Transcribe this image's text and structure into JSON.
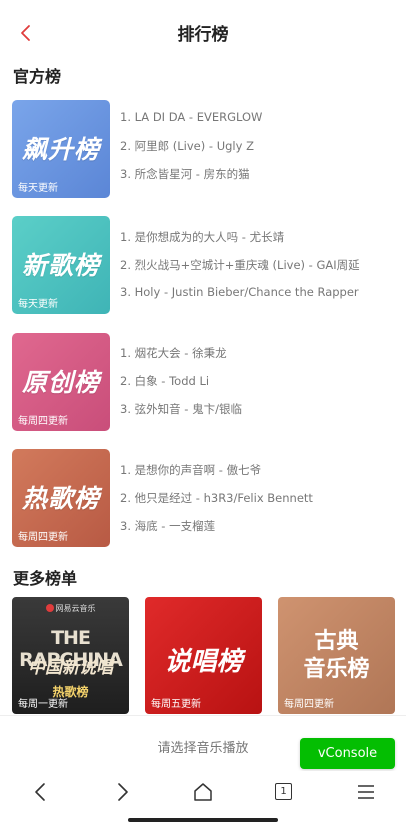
{
  "header": {
    "title": "排行榜",
    "back_icon": "chevron-left-icon",
    "accent": "#e03c3c"
  },
  "official": {
    "title": "官方榜",
    "boards": [
      {
        "art": "飙升榜",
        "frequency": "每天更新",
        "color": "#6a9ae0",
        "songs": [
          "1. LA DI DA - EVERGLOW",
          "2. 阿里郎 (Live) - Ugly Z",
          "3. 所念皆星河 - 房东的猫"
        ]
      },
      {
        "art": "新歌榜",
        "frequency": "每天更新",
        "color": "#4fc2c0",
        "songs": [
          "1. 是你想成为的大人吗 - 尤长靖",
          "2. 烈火战马+空城计+重庆魂 (Live) - GAI周延",
          "3. Holy - Justin Bieber/Chance the Rapper"
        ]
      },
      {
        "art": "原创榜",
        "frequency": "每周四更新",
        "color": "#d65c86",
        "songs": [
          "1. 烟花大会 - 徐秉龙",
          "2. 白象 - Todd Li",
          "3. 弦外知音 - 鬼卞/银临"
        ]
      },
      {
        "art": "热歌榜",
        "frequency": "每周四更新",
        "color": "#c96a4f",
        "songs": [
          "1. 是想你的声音啊 - 傲七爷",
          "2. 他只是经过 - h3R3/Felix Bennett",
          "3. 海底 - 一支榴莲"
        ]
      }
    ]
  },
  "more": {
    "title": "更多榜单",
    "cards": [
      {
        "brand": "网易云音乐",
        "logo": "THE RAPCHINA",
        "sub": "中国新说唱",
        "name": "热歌榜",
        "frequency": "每周一更新",
        "color": "#2a2a2a"
      },
      {
        "name": "说唱榜",
        "frequency": "每周五更新",
        "color": "#d11d1d"
      },
      {
        "name_line1": "古典",
        "name_line2": "音乐榜",
        "frequency": "每周四更新",
        "color": "#c08663"
      }
    ]
  },
  "bottom": {
    "hint": "请选择音乐播放",
    "vconsole": "vConsole"
  },
  "nav": {
    "tab_count": "1"
  }
}
